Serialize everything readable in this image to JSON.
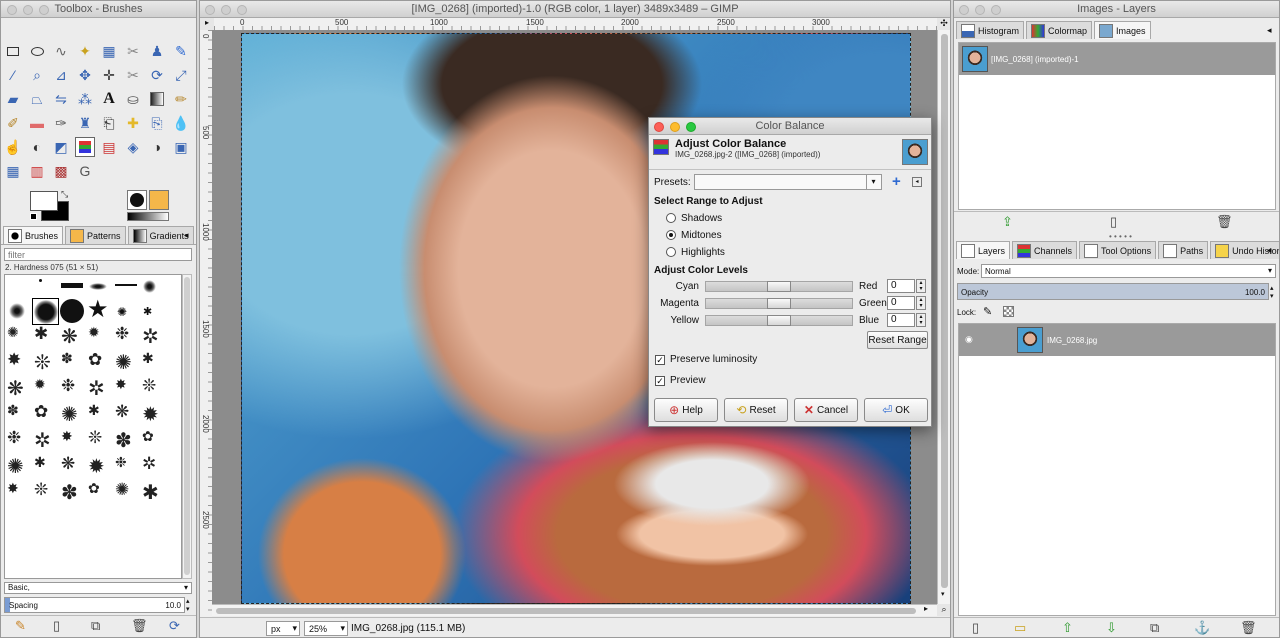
{
  "toolbox": {
    "title": "Toolbox - Brushes",
    "tabs": [
      "Brushes",
      "Patterns",
      "Gradients"
    ],
    "filter_placeholder": "filter",
    "brush_name": "2. Hardness 075 (51 × 51)",
    "preset": "Basic,",
    "spacing_label": "Spacing",
    "spacing_value": "10.0"
  },
  "image_window": {
    "title": "[IMG_0268] (imported)-1.0 (RGB color, 1 layer) 3489x3489 – GIMP",
    "ruler_marks": [
      "0",
      "500",
      "1000",
      "1500",
      "2000",
      "2500",
      "3000"
    ],
    "vruler_marks": [
      "0",
      "500",
      "1000",
      "1500",
      "2000",
      "2500"
    ],
    "unit": "px",
    "zoom": "25%",
    "status": "IMG_0268.jpg (115.1 MB)"
  },
  "dialog": {
    "title": "Color Balance",
    "heading": "Adjust Color Balance",
    "subheading": "IMG_0268.jpg-2 ([IMG_0268] (imported))",
    "presets_label": "Presets:",
    "range_label": "Select Range to Adjust",
    "ranges": [
      "Shadows",
      "Midtones",
      "Highlights"
    ],
    "selected_range": "Midtones",
    "levels_label": "Adjust Color Levels",
    "levels": [
      {
        "left": "Cyan",
        "right": "Red",
        "value": "0"
      },
      {
        "left": "Magenta",
        "right": "Green",
        "value": "0"
      },
      {
        "left": "Yellow",
        "right": "Blue",
        "value": "0"
      }
    ],
    "reset_range": "Reset Range",
    "preserve_luminosity": "Preserve luminosity",
    "preview": "Preview",
    "buttons": {
      "help": "Help",
      "reset": "Reset",
      "cancel": "Cancel",
      "ok": "OK"
    }
  },
  "layers_window": {
    "title": "Images - Layers",
    "top_tabs": [
      "Histogram",
      "Colormap",
      "Images"
    ],
    "image_item": "[IMG_0268] (imported)-1",
    "tabs": [
      "Layers",
      "Channels",
      "Tool Options",
      "Paths",
      "Undo History"
    ],
    "mode_label": "Mode:",
    "mode_value": "Normal",
    "opacity_label": "Opacity",
    "opacity_value": "100.0",
    "lock_label": "Lock:",
    "layer_name": "IMG_0268.jpg"
  }
}
